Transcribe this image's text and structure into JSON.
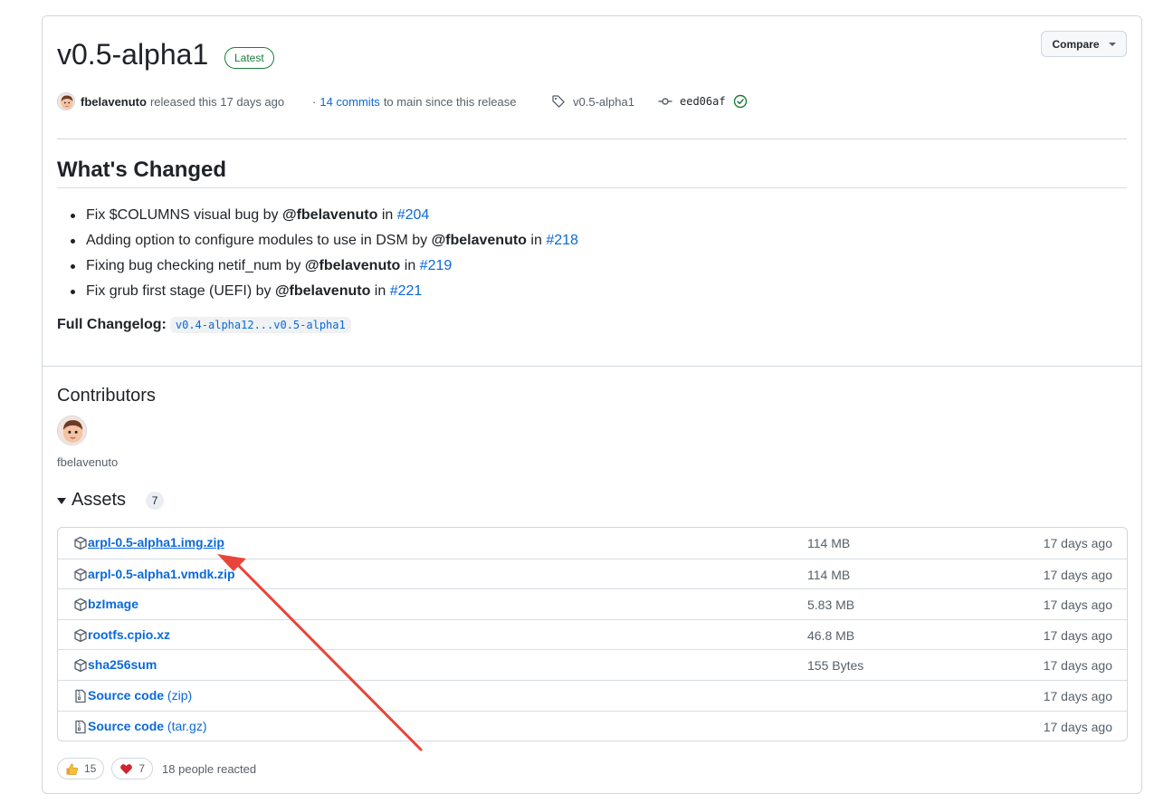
{
  "release": {
    "title": "v0.5-alpha1",
    "badge": "Latest",
    "compare_label": "Compare"
  },
  "meta": {
    "author": "fbelavenuto",
    "released_text": "released this 17 days ago",
    "commits_prefix": "·",
    "commits_link": "14 commits",
    "commits_suffix": "to main since this release",
    "tag": "v0.5-alpha1",
    "commit_sha": "eed06af"
  },
  "whats_changed": {
    "heading": "What's Changed",
    "items": [
      {
        "text": "Fix $COLUMNS visual bug by",
        "mention": "@fbelavenuto",
        "in": "in",
        "pr": "#204"
      },
      {
        "text": "Adding option to configure modules to use in DSM by",
        "mention": "@fbelavenuto",
        "in": "in",
        "pr": "#218"
      },
      {
        "text": "Fixing bug checking netif_num by",
        "mention": "@fbelavenuto",
        "in": "in",
        "pr": "#219"
      },
      {
        "text": "Fix grub first stage (UEFI) by",
        "mention": "@fbelavenuto",
        "in": "in",
        "pr": "#221"
      }
    ],
    "changelog_label": "Full Changelog:",
    "changelog_link": "v0.4-alpha12...v0.5-alpha1"
  },
  "contributors": {
    "heading": "Contributors",
    "names": [
      "fbelavenuto"
    ]
  },
  "assets": {
    "heading": "Assets",
    "count": "7",
    "rows": [
      {
        "name": "arpl-0.5-alpha1.img.zip",
        "sub": "",
        "size": "114 MB",
        "time": "17 days ago",
        "icon": "package-icon"
      },
      {
        "name": "arpl-0.5-alpha1.vmdk.zip",
        "sub": "",
        "size": "114 MB",
        "time": "17 days ago",
        "icon": "package-icon"
      },
      {
        "name": "bzImage",
        "sub": "",
        "size": "5.83 MB",
        "time": "17 days ago",
        "icon": "package-icon"
      },
      {
        "name": "rootfs.cpio.xz",
        "sub": "",
        "size": "46.8 MB",
        "time": "17 days ago",
        "icon": "package-icon"
      },
      {
        "name": "sha256sum",
        "sub": "",
        "size": "155 Bytes",
        "time": "17 days ago",
        "icon": "package-icon"
      },
      {
        "name": "Source code",
        "sub": "(zip)",
        "size": "",
        "time": "17 days ago",
        "icon": "file-zip-icon"
      },
      {
        "name": "Source code",
        "sub": "(tar.gz)",
        "size": "",
        "time": "17 days ago",
        "icon": "file-zip-icon"
      }
    ]
  },
  "reactions": {
    "thumbs_up_count": "15",
    "heart_count": "7",
    "summary": "18 people reacted"
  },
  "colors": {
    "link": "#0969da",
    "success": "#1a7f37",
    "annotation_arrow": "#e8443a"
  }
}
